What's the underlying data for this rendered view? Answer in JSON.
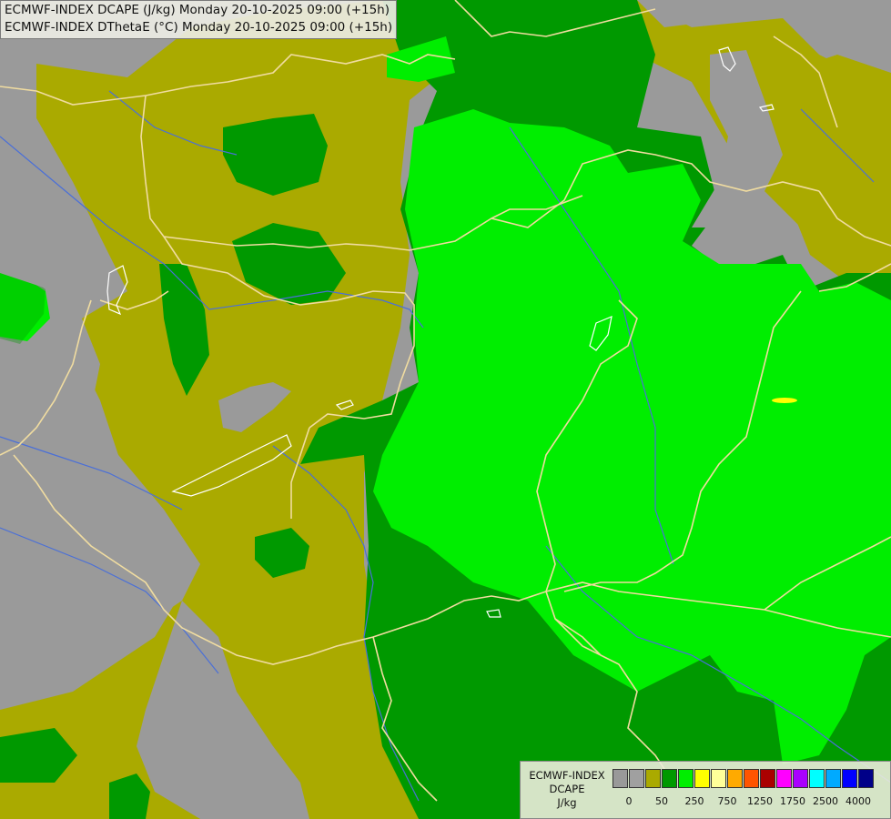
{
  "title": {
    "line1": "ECMWF-INDEX DCAPE (J/kg) Monday 20-10-2025 09:00 (+15h)",
    "line2": "ECMWF-INDEX DThetaE (°C) Monday 20-10-2025 09:00 (+15h)"
  },
  "legend": {
    "label_line1": "ECMWF-INDEX",
    "label_line2": "DCAPE",
    "label_line3": "J/kg",
    "colors": [
      "#999999",
      "#a0a0a0",
      "#aaaa00",
      "#009900",
      "#00ee00",
      "#ffff00",
      "#ffff99",
      "#ffaa00",
      "#ff5500",
      "#aa0000",
      "#ff00ff",
      "#aa00ff",
      "#00ffff",
      "#00aaff",
      "#0000ff",
      "#000088"
    ],
    "ticks": [
      "0",
      "50",
      "250",
      "750",
      "1250",
      "1750",
      "2500",
      "4000"
    ]
  },
  "colors": {
    "nodata": "#9a9a9a",
    "olive": "#aaaa00",
    "dark_green": "#009900",
    "bright_green": "#00ee00",
    "border": "#f0dca0",
    "river": "#4a6fd8"
  }
}
